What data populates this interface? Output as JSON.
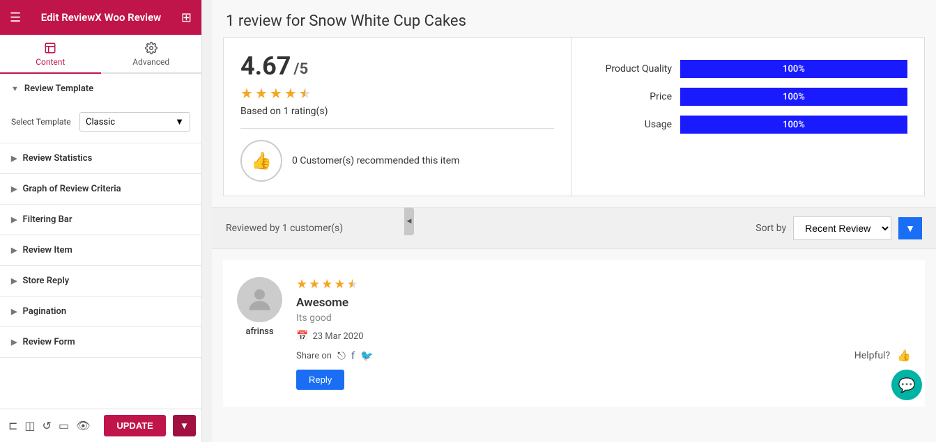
{
  "sidebar": {
    "header": {
      "title": "Edit ReviewX Woo Review",
      "hamburger": "☰",
      "grid_icon": "⊞"
    },
    "tabs": [
      {
        "id": "content",
        "label": "Content",
        "active": true
      },
      {
        "id": "advanced",
        "label": "Advanced",
        "active": false
      }
    ],
    "accordion": [
      {
        "id": "review-template",
        "label": "Review Template",
        "open": true,
        "body": {
          "select_label": "Select Template",
          "select_value": "Classic"
        }
      },
      {
        "id": "review-statistics",
        "label": "Review Statistics",
        "open": false
      },
      {
        "id": "graph-of-review-criteria",
        "label": "Graph of Review Criteria",
        "open": false
      },
      {
        "id": "filtering-bar",
        "label": "Filtering Bar",
        "open": false
      },
      {
        "id": "review-item",
        "label": "Review Item",
        "open": false
      },
      {
        "id": "store-reply",
        "label": "Store Reply",
        "open": false
      },
      {
        "id": "pagination",
        "label": "Pagination",
        "open": false
      },
      {
        "id": "review-form",
        "label": "Review Form",
        "open": false
      }
    ],
    "toolbar": {
      "update_label": "UPDATE"
    }
  },
  "main": {
    "page_title": "1 review for Snow White Cup Cakes",
    "stats_left": {
      "rating": "4.67",
      "rating_max": "/5",
      "stars": [
        1,
        1,
        1,
        1,
        0.5
      ],
      "based_on": "Based on 1 rating(s)",
      "recommend": "0 Customer(s) recommended this item"
    },
    "stats_right": {
      "criteria": [
        {
          "label": "Product Quality",
          "pct": 100
        },
        {
          "label": "Price",
          "pct": 100
        },
        {
          "label": "Usage",
          "pct": 100
        }
      ]
    },
    "filter_bar": {
      "reviewed_by": "Reviewed by 1 customer(s)",
      "sort_label": "Sort by",
      "sort_value": "Recent Review"
    },
    "review": {
      "reviewer": "afrinss",
      "stars": [
        1,
        1,
        1,
        1,
        0.5
      ],
      "title": "Awesome",
      "text": "Its good",
      "date": "23 Mar 2020",
      "share_label": "Share on",
      "helpful_label": "Helpful?",
      "reply_label": "Reply"
    }
  },
  "colors": {
    "sidebar_header_bg": "#c0154a",
    "tab_active": "#c0154a",
    "bar_blue": "#1a1aff",
    "sort_btn_blue": "#1a6ef5",
    "fab_teal": "#00b3a4",
    "star_gold": "#f5a623"
  }
}
